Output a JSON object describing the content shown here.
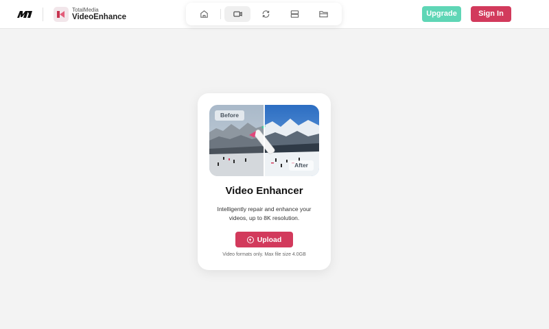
{
  "header": {
    "brand_small": "TotalMedia",
    "app_name": "VideoEnhance",
    "nav_items": [
      {
        "icon": "home-icon",
        "active": false
      },
      {
        "icon": "video-camera-icon",
        "active": true
      },
      {
        "icon": "refresh-icon",
        "active": false
      },
      {
        "icon": "storage-icon",
        "active": false
      },
      {
        "icon": "folder-icon",
        "active": false
      }
    ],
    "upgrade_label": "Upgrade",
    "signin_label": "Sign In"
  },
  "card": {
    "before_label": "Before",
    "after_label": "After",
    "title": "Video Enhancer",
    "description": "Intelligently repair and enhance your videos, up to 8K resolution.",
    "upload_label": "Upload",
    "note": "Video formats only. Max file size 4.0GB"
  },
  "colors": {
    "accent": "#d23a5c",
    "upgrade": "#5fd6b6",
    "background": "#f3f3f3"
  }
}
